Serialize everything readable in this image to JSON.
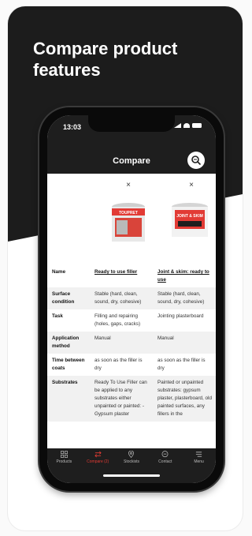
{
  "headline": "Compare product features",
  "status": {
    "time": "13:03"
  },
  "header": {
    "title": "Compare"
  },
  "products": [
    {
      "remove_label": "×",
      "name": "Ready to use filler",
      "brand_text": "TOUPRET"
    },
    {
      "remove_label": "×",
      "name": "Joint & skim: ready to use",
      "brand_text": "JOINT & SKIM"
    }
  ],
  "table": {
    "rows": [
      {
        "label": "Name",
        "values": [
          "Ready to use filler",
          "Joint & skim: ready to use"
        ]
      },
      {
        "label": "Surface condition",
        "values": [
          "Stable (hard, clean, sound, dry, cohesive)",
          "Stable (hard, clean, sound, dry, cohesive)"
        ]
      },
      {
        "label": "Task",
        "values": [
          "Filling and repairing (holes, gaps, cracks)",
          "Jointing plasterboard"
        ]
      },
      {
        "label": "Application method",
        "values": [
          "Manual",
          "Manual"
        ]
      },
      {
        "label": "Time between coats",
        "values": [
          "as soon as the filler is dry",
          "as soon as the filler is dry"
        ]
      },
      {
        "label": "Substrates",
        "values": [
          "Ready To Use Filler can be applied to any substrates either unpainted or painted: - Gypsum plaster",
          "Painted or unpainted substrates: gypsum plaster, plasterboard, old painted surfaces, any fillers in the"
        ]
      }
    ]
  },
  "tabs": [
    {
      "label": "Products",
      "icon": "grid-icon",
      "active": false
    },
    {
      "label": "Compare (2)",
      "icon": "compare-arrows-icon",
      "active": true
    },
    {
      "label": "Stockists",
      "icon": "location-pin-icon",
      "active": false
    },
    {
      "label": "Contact",
      "icon": "chat-bubble-icon",
      "active": false
    },
    {
      "label": "Menu",
      "icon": "menu-icon",
      "active": false
    }
  ],
  "colors": {
    "dark": "#1c1c1c",
    "accent": "#e43b34"
  }
}
